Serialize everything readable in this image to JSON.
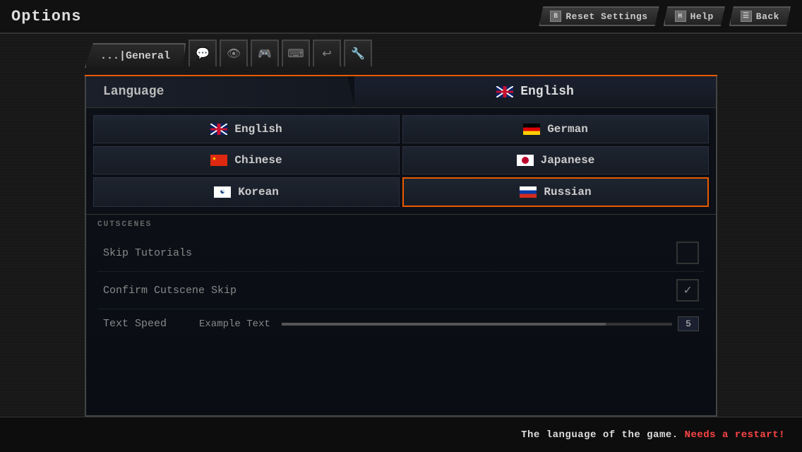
{
  "topBar": {
    "title": "Options",
    "buttons": [
      {
        "id": "reset",
        "icon": "B",
        "label": "Reset Settings"
      },
      {
        "id": "help",
        "icon": "H",
        "label": "Help"
      },
      {
        "id": "back",
        "icon": "☰",
        "label": "Back"
      }
    ]
  },
  "tabs": {
    "active": "General",
    "activeLabel": "...|General",
    "icons": [
      "💬",
      "👁",
      "🎮",
      "⌨",
      "↩",
      "🔧"
    ]
  },
  "languageSection": {
    "label": "Language",
    "currentValue": "English",
    "flagEmoji": "🇬🇧"
  },
  "languages": [
    {
      "id": "english",
      "name": "English",
      "flag": "uk",
      "selected": true
    },
    {
      "id": "german",
      "name": "German",
      "flag": "de",
      "selected": false
    },
    {
      "id": "chinese",
      "name": "Chinese",
      "flag": "cn",
      "selected": false
    },
    {
      "id": "japanese",
      "name": "Japanese",
      "flag": "jp",
      "selected": false
    },
    {
      "id": "korean",
      "name": "Korean",
      "flag": "kr",
      "selected": false
    },
    {
      "id": "russian",
      "name": "Russian",
      "flag": "ru",
      "selected": true
    }
  ],
  "cutscenes": {
    "sectionLabel": "CUTSCENES",
    "rows": [
      {
        "id": "skip-tutorials",
        "label": "Skip Tutorials",
        "checked": false
      },
      {
        "id": "confirm-cutscene-skip",
        "label": "Confirm Cutscene Skip",
        "checked": true
      }
    ]
  },
  "textSpeed": {
    "label": "Text Speed",
    "exampleText": "Example Text",
    "value": "5",
    "sliderPercent": 83
  },
  "statusBar": {
    "text": "The language of the game.",
    "highlight": "Needs a restart!"
  }
}
